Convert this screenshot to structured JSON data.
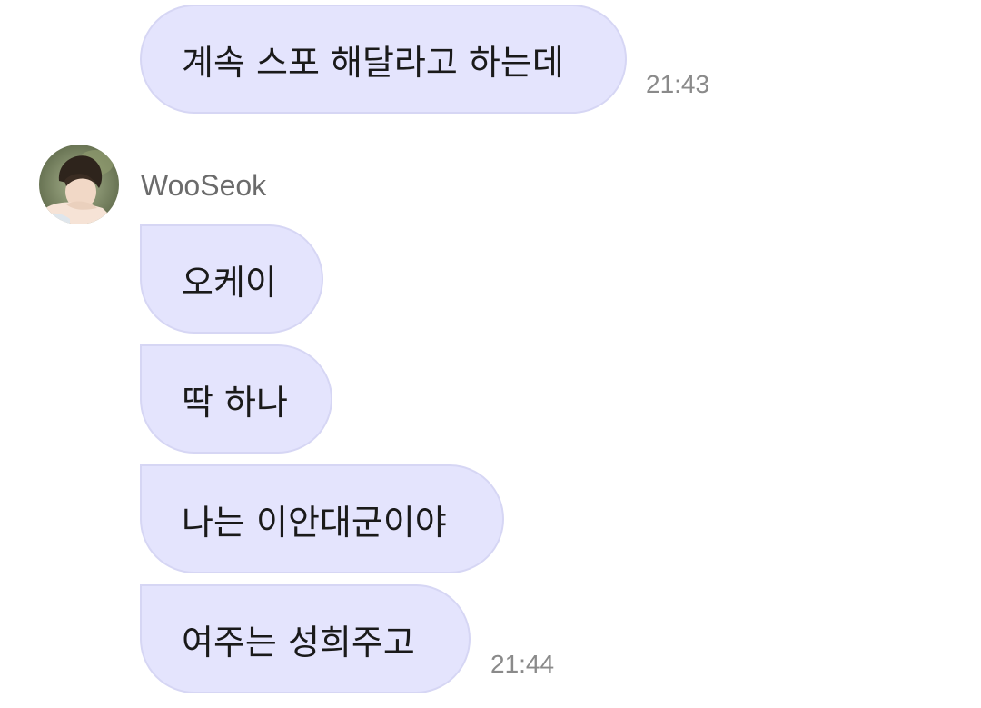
{
  "chat": {
    "previous": {
      "text": "계속 스포 해달라고 하는데",
      "time": "21:43"
    },
    "sender_name": "WooSeok",
    "messages": [
      {
        "text": "오케이"
      },
      {
        "text": "딱 하나"
      },
      {
        "text": "나는 이안대군이야"
      },
      {
        "text": "여주는 성희주고"
      }
    ],
    "last_time": "21:44"
  },
  "colors": {
    "bubble": "#e4e4fd",
    "bubble_border": "#d6d6f4",
    "time": "#8a8a8a",
    "sender": "#6b6b6b"
  },
  "icons": {
    "avatar": "profile-photo"
  }
}
